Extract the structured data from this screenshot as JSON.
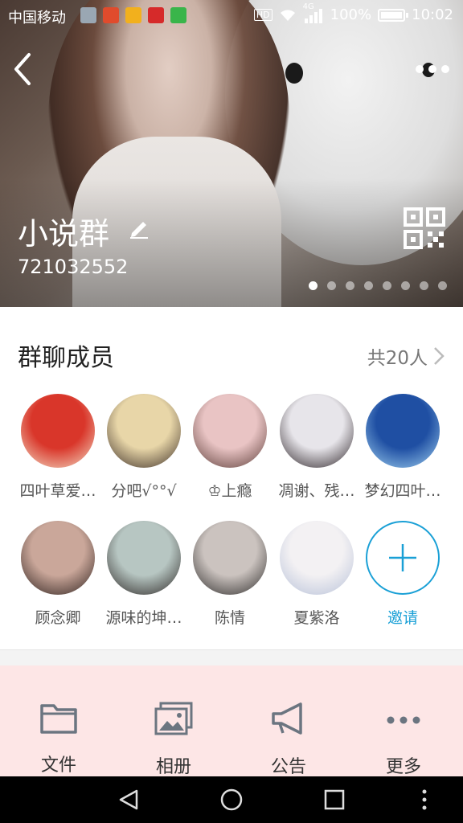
{
  "status_bar": {
    "carrier": "中国移动",
    "network": "4G",
    "battery": "100%",
    "time": "10:02",
    "app_icon_colors": [
      "#9aa7b3",
      "#e04b2c",
      "#f2b01d",
      "#d62a2a",
      "#39b54a"
    ]
  },
  "header": {
    "group_name": "小说群",
    "group_id": "721032552",
    "photo_pages": 8,
    "active_page": 1
  },
  "members": {
    "title": "群聊成员",
    "count_label": "共20人",
    "items": [
      {
        "name": "四叶草爱…",
        "colors": [
          "#d9362a",
          "#f3e0c8"
        ]
      },
      {
        "name": "分吧√°°√",
        "colors": [
          "#e8d6a8",
          "#3a2c25"
        ]
      },
      {
        "name": "♔上瘾",
        "colors": [
          "#e9c4c4",
          "#5a3b36"
        ]
      },
      {
        "name": "凋谢、残…",
        "colors": [
          "#e7e5ea",
          "#2b2226"
        ]
      },
      {
        "name": "梦幻四叶…",
        "colors": [
          "#1f4fa3",
          "#9fd0f0"
        ]
      },
      {
        "name": "顾念卿",
        "colors": [
          "#caa79a",
          "#2c1f1c"
        ]
      },
      {
        "name": "源味的坤…",
        "colors": [
          "#b7c6c2",
          "#2a2422"
        ]
      },
      {
        "name": "陈情",
        "colors": [
          "#cbc3bf",
          "#2c2a29"
        ]
      },
      {
        "name": "夏紫洛",
        "colors": [
          "#f3f1f3",
          "#b6c0d8"
        ]
      }
    ],
    "invite_label": "邀请"
  },
  "toolbar": {
    "items": [
      {
        "label": "文件",
        "icon": "folder-icon"
      },
      {
        "label": "相册",
        "icon": "album-icon"
      },
      {
        "label": "公告",
        "icon": "megaphone-icon"
      },
      {
        "label": "更多",
        "icon": "more-horizontal-icon"
      }
    ]
  },
  "colors": {
    "accent": "#1aa0d6",
    "toolbar_bg": "#fde6e6"
  }
}
